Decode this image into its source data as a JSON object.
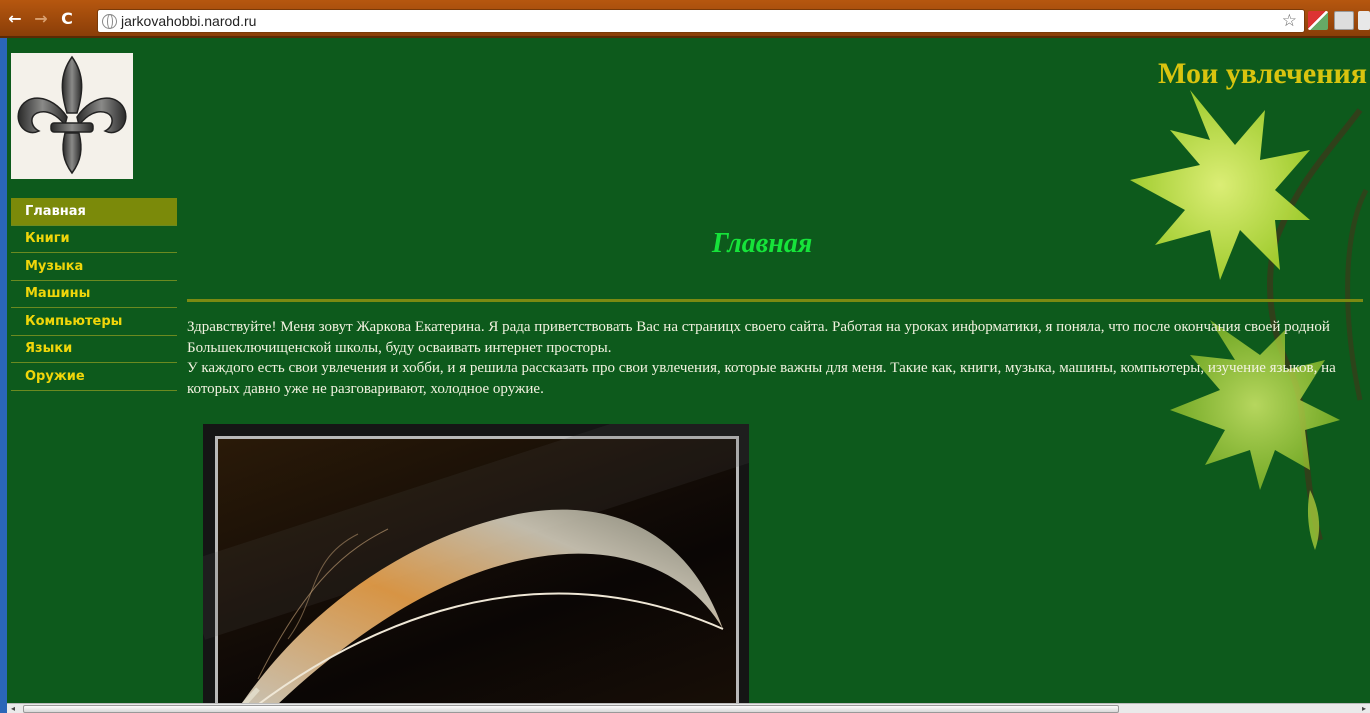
{
  "browser": {
    "url": "jarkovahobbi.narod.ru",
    "back_icon": "←",
    "forward_icon": "→",
    "reload_icon": "C",
    "bookmark_icon": "☆"
  },
  "site": {
    "title": "Мои увлечения"
  },
  "menu": {
    "items": [
      {
        "label": "Главная"
      },
      {
        "label": "Книги"
      },
      {
        "label": "Музыка"
      },
      {
        "label": "Машины"
      },
      {
        "label": "Компьютеры"
      },
      {
        "label": "Языки"
      },
      {
        "label": "Оружие"
      }
    ]
  },
  "main": {
    "heading": "Главная",
    "paragraph1": "Здравствуйте! Меня зовут Жаркова Екатерина. Я рада приветствовать Вас на страницх своего сайта. Работая на уроках информатики, я поняла, что после окончания своей родной Большеключищенской школы, буду осваивать интернет просторы.",
    "paragraph2": "У каждого есть свои увлечения и хобби, и я решила рассказать про свои увлечения, которые важны для меня. Такие как, книги, музыка, машины, компьютеры, изучение языков, на которых давно уже не разговаривают, холодное оружие."
  },
  "colors": {
    "page_bg": "#0d5a1c",
    "menu_active_bg": "#7b8a0a",
    "menu_text": "#f0d60a",
    "heading": "#16e33a",
    "site_title": "#d9c40f"
  }
}
